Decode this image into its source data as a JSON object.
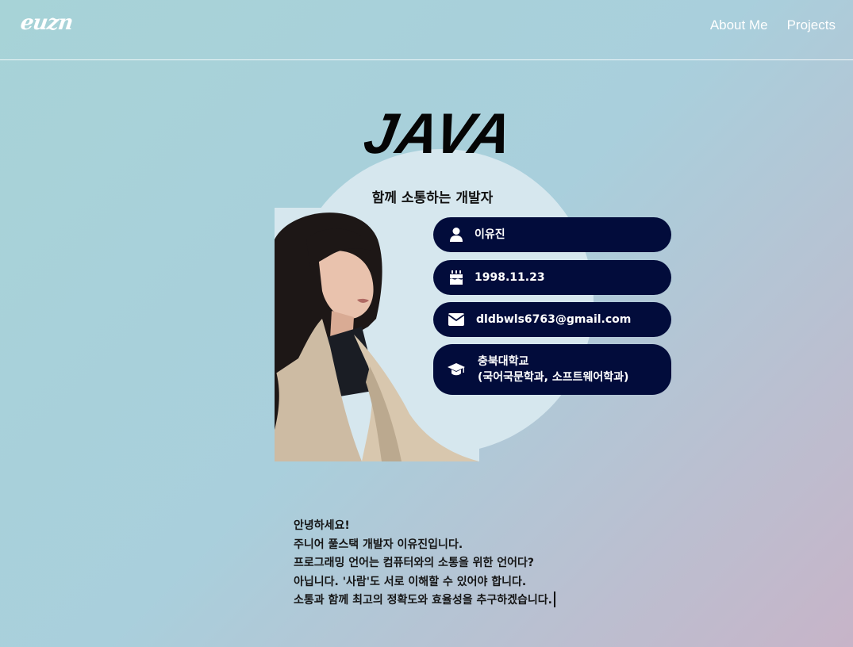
{
  "header": {
    "logo": "euzn",
    "nav": [
      {
        "label": "About Me"
      },
      {
        "label": "Projects"
      }
    ]
  },
  "hero": {
    "title": "JAVA",
    "subtitle": "함께 소통하는 개발자"
  },
  "profile": {
    "name": "이유진",
    "birthdate": "1998.11.23",
    "email": "dldbwls6763@gmail.com",
    "school": "충북대학교",
    "major": "(국어국문학과, 소프트웨어학과)"
  },
  "icons": {
    "name": "user-icon",
    "birthdate": "birthday-cake-icon",
    "email": "envelope-icon",
    "school": "graduation-cap-icon"
  },
  "intro": [
    "안녕하세요!",
    "주니어 풀스택 개발자 이유진입니다.",
    "프로그래밍 언어는 컴퓨터와의 소통을 위한 언어다?",
    "아닙니다. '사람'도 서로 이해할 수 있어야 합니다.",
    "소통과 함께 최고의 정확도와 효율성을 추구하겠습니다."
  ],
  "colors": {
    "pill_background": "#020c3b",
    "circle": "#d6e7ee",
    "gradient_start": "#a7d3d7",
    "gradient_end": "#c7b4c8"
  }
}
